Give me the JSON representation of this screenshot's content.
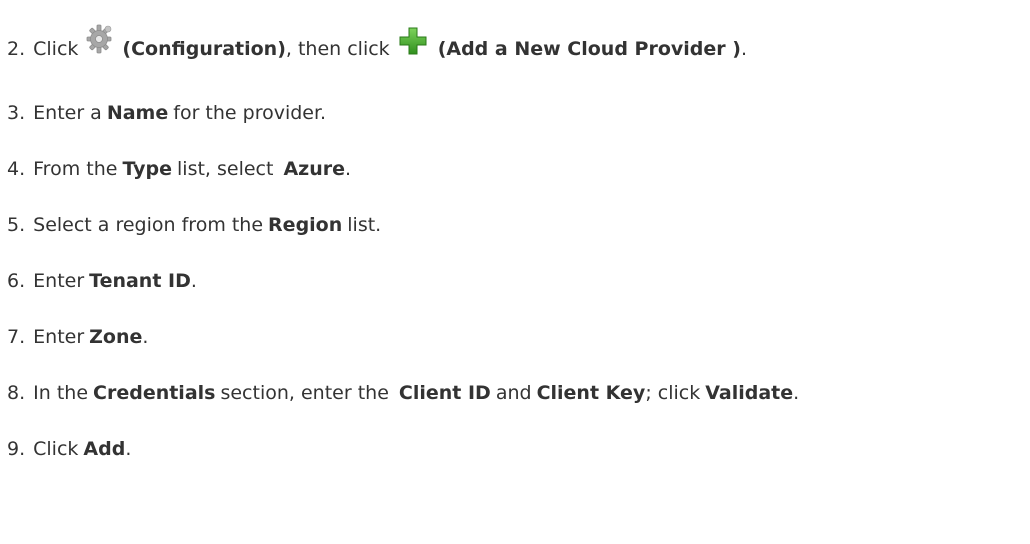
{
  "steps": [
    {
      "number": "2.",
      "parts": {
        "t1": "Click",
        "icon1": "gear-icon",
        "b1": "(Configuration)",
        "t2": ", then click",
        "icon2": "plus-icon",
        "b2": "(Add a New Cloud Provider )",
        "t3": "."
      }
    },
    {
      "number": "3.",
      "parts": {
        "t1": "Enter a",
        "b1": "Name",
        "t2": "for the provider."
      }
    },
    {
      "number": "4.",
      "parts": {
        "t1": "From the",
        "b1": "Type",
        "t2": "list, select",
        "b2": "Azure",
        "t3": "."
      }
    },
    {
      "number": "5.",
      "parts": {
        "t1": "Select a region from the",
        "b1": "Region",
        "t2": "list."
      }
    },
    {
      "number": "6.",
      "parts": {
        "t1": "Enter",
        "b1": "Tenant ID",
        "t2": "."
      }
    },
    {
      "number": "7.",
      "parts": {
        "t1": "Enter",
        "b1": "Zone",
        "t2": "."
      }
    },
    {
      "number": "8.",
      "parts": {
        "t1": "In the",
        "b1": "Credentials",
        "t2": "section, enter the",
        "b2": "Client ID",
        "t3": "and",
        "b3": "Client Key",
        "t4": "; click",
        "b4": "Validate",
        "t5": "."
      }
    },
    {
      "number": "9.",
      "parts": {
        "t1": "Click",
        "b1": "Add",
        "t2": "."
      }
    }
  ],
  "colors": {
    "text": "#333333",
    "gear": "#9a9a9a",
    "plus": "#43a82a"
  }
}
